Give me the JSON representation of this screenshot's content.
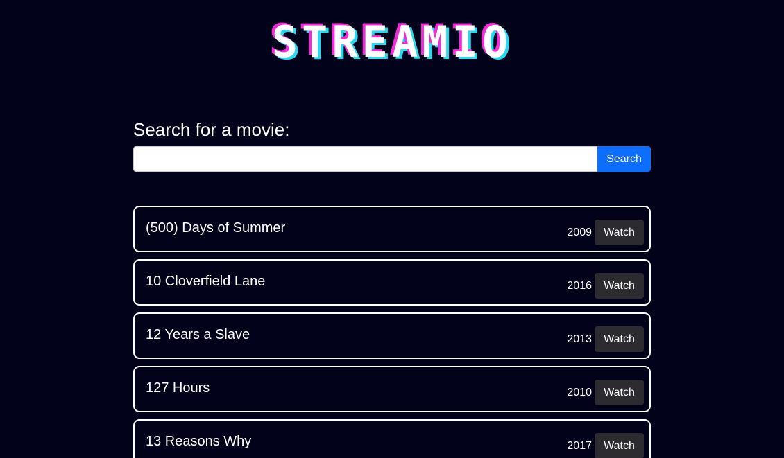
{
  "header": {
    "logo_text": "STREAMIO",
    "colors": {
      "shadow_pink": "#f22bd8",
      "shadow_cyan": "#27d8ee",
      "background": "#02021a"
    }
  },
  "search": {
    "heading": "Search for a movie:",
    "value": "",
    "placeholder": "",
    "button_label": "Search",
    "button_color": "#0d6efd"
  },
  "movies": [
    {
      "title": "(500) Days of Summer",
      "year": "2009",
      "action": "Watch"
    },
    {
      "title": "10 Cloverfield Lane",
      "year": "2016",
      "action": "Watch"
    },
    {
      "title": "12 Years a Slave",
      "year": "2013",
      "action": "Watch"
    },
    {
      "title": "127 Hours",
      "year": "2010",
      "action": "Watch"
    },
    {
      "title": "13 Reasons Why",
      "year": "2017",
      "action": "Watch"
    }
  ]
}
